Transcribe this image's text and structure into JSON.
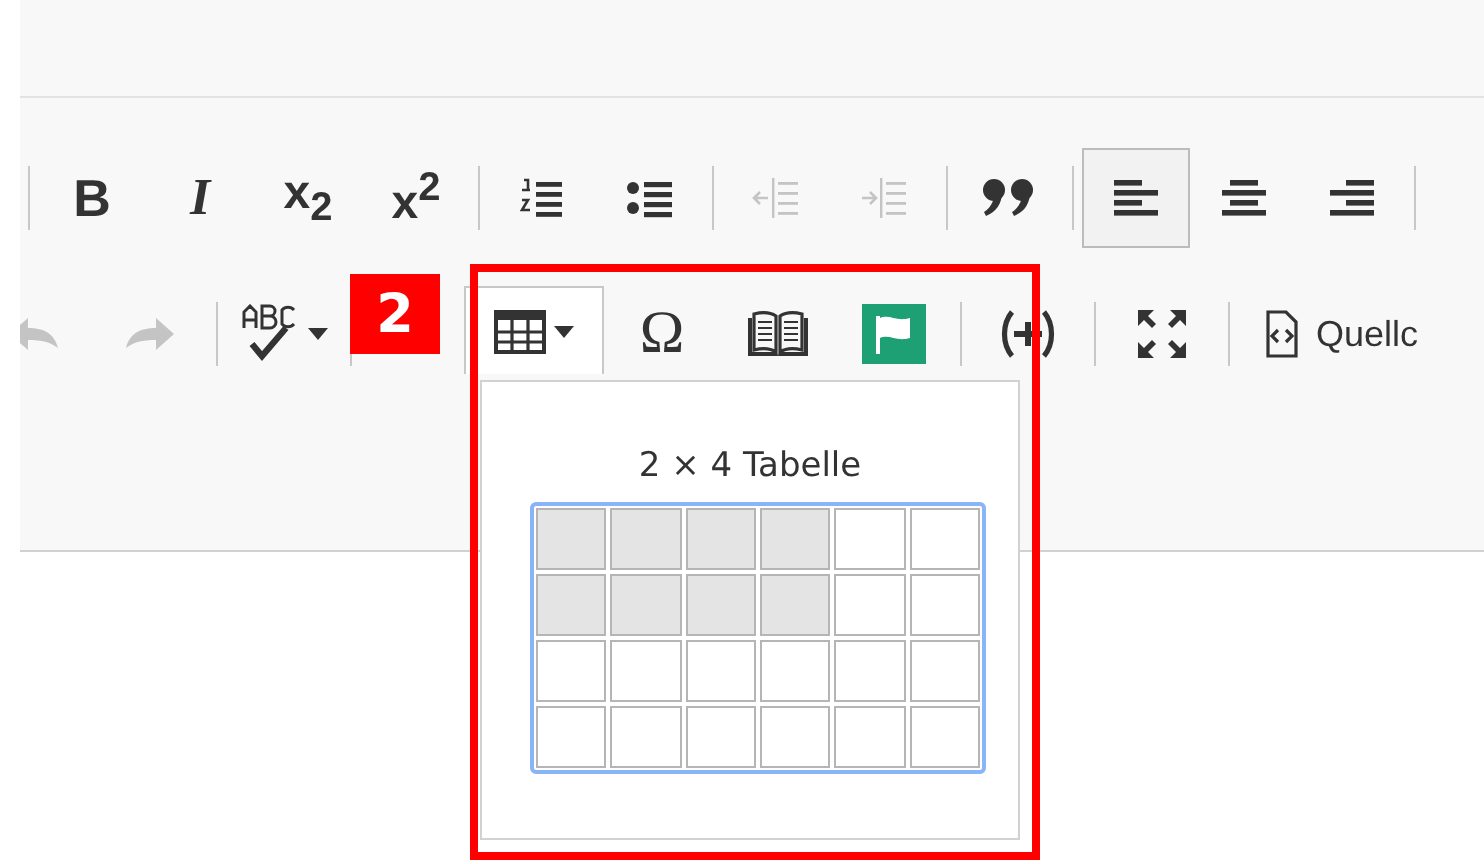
{
  "toolbar_row_1": [
    {
      "kind": "separator"
    },
    {
      "kind": "bold",
      "label": "B",
      "disabled": false,
      "selected": false
    },
    {
      "kind": "italic",
      "label": "I",
      "disabled": false,
      "selected": false
    },
    {
      "kind": "script",
      "label": "x$_{2}$",
      "disabled": false,
      "selected": false
    },
    {
      "kind": "script",
      "label": "x$^{2}$",
      "disabled": false,
      "selected": false
    },
    {
      "kind": "separator"
    },
    {
      "kind": "numbered-list",
      "disabled": false,
      "selected": false
    },
    {
      "kind": "bullet-list",
      "disabled": false,
      "selected": false
    },
    {
      "kind": "separator"
    },
    {
      "kind": "outdent",
      "disabled": true,
      "selected": false
    },
    {
      "kind": "indent",
      "disabled": true,
      "selected": false
    },
    {
      "kind": "separator"
    },
    {
      "kind": "quote",
      "disabled": false,
      "selected": false
    },
    {
      "kind": "separator"
    },
    {
      "kind": "align-left",
      "disabled": false,
      "selected": true
    },
    {
      "kind": "align-center",
      "disabled": false,
      "selected": false
    },
    {
      "kind": "align-right",
      "disabled": false,
      "selected": false
    },
    {
      "kind": "separator"
    }
  ],
  "toolbar_row_2": [
    {
      "kind": "undo",
      "disabled": true,
      "selected": false
    },
    {
      "kind": "redo",
      "disabled": true,
      "selected": false
    },
    {
      "kind": "separator"
    },
    {
      "kind": "spellcheck",
      "disabled": false,
      "selected": false
    },
    {
      "kind": "separator"
    },
    {
      "kind": "table",
      "disabled": false,
      "selected": true
    },
    {
      "kind": "symbol",
      "label": "Ω",
      "disabled": false,
      "selected": false
    },
    {
      "kind": "book",
      "disabled": false,
      "selected": false
    },
    {
      "kind": "flag",
      "selected": false
    },
    {
      "kind": "separator"
    },
    {
      "kind": "placeholder",
      "disabled": false,
      "selected": false
    },
    {
      "kind": "separator"
    },
    {
      "kind": "maximize",
      "disabled": false,
      "selected": false
    },
    {
      "kind": "separator"
    },
    {
      "kind": "source",
      "label": "Quellc",
      "disabled": false,
      "selected": false
    }
  ],
  "badge": "2",
  "table_picker": {
    "title": "2 × 4 Tabelle",
    "rows": [
      [
        {
          "selected": true
        },
        {
          "selected": true
        },
        {
          "selected": true
        },
        {
          "selected": true
        },
        {
          "selected": false
        },
        {
          "selected": false
        }
      ],
      [
        {
          "selected": true
        },
        {
          "selected": true
        },
        {
          "selected": true
        },
        {
          "selected": true
        },
        {
          "selected": false
        },
        {
          "selected": false
        }
      ],
      [
        {
          "selected": false
        },
        {
          "selected": false
        },
        {
          "selected": false
        },
        {
          "selected": false
        },
        {
          "selected": false
        },
        {
          "selected": false
        }
      ],
      [
        {
          "selected": false
        },
        {
          "selected": false
        },
        {
          "selected": false
        },
        {
          "selected": false
        },
        {
          "selected": false
        },
        {
          "selected": false
        }
      ]
    ]
  }
}
